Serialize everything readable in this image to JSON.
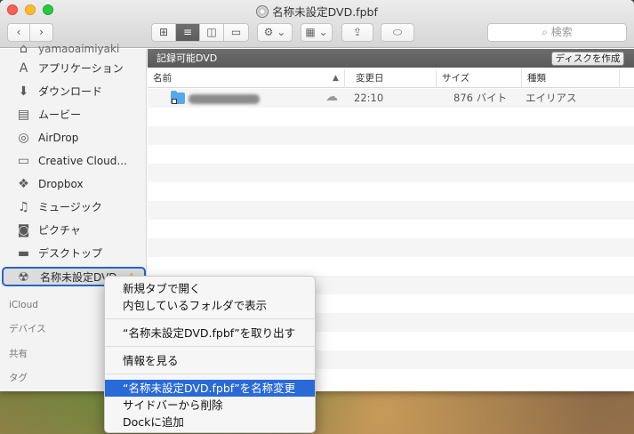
{
  "window": {
    "title": "名称未設定DVD.fpbf"
  },
  "toolbar": {
    "back_label": "‹",
    "forward_label": "›",
    "view_icons_label": "⊞",
    "view_list_label": "≡",
    "view_columns_label": "◫",
    "view_coverflow_label": "▭",
    "action_label": "⚙ ⌄",
    "arrange_label": "▦ ⌄",
    "share_label": "⇪",
    "tags_label": "⬭",
    "search_placeholder": "検索"
  },
  "sidebar": {
    "items": [
      {
        "label": "yamaoaimiyaki",
        "icon": "home-icon"
      },
      {
        "label": "アプリケーション",
        "icon": "applications-icon"
      },
      {
        "label": "ダウンロード",
        "icon": "download-icon"
      },
      {
        "label": "ムービー",
        "icon": "film-icon"
      },
      {
        "label": "AirDrop",
        "icon": "airdrop-icon"
      },
      {
        "label": "Creative Cloud...",
        "icon": "folder-icon"
      },
      {
        "label": "Dropbox",
        "icon": "dropbox-icon"
      },
      {
        "label": "ミュージック",
        "icon": "music-icon"
      },
      {
        "label": "ピクチャ",
        "icon": "camera-icon"
      },
      {
        "label": "デスクトップ",
        "icon": "desktop-icon"
      },
      {
        "label": "名称未設定DVD",
        "icon": "burn-disc-icon"
      }
    ],
    "sections": [
      "iCloud",
      "デバイス",
      "共有",
      "タグ"
    ]
  },
  "pathbar": {
    "title": "記録可能DVD",
    "burn_button": "ディスクを作成"
  },
  "columns": {
    "name": "名前",
    "modified": "変更日",
    "size": "サイズ",
    "kind": "種類"
  },
  "files": [
    {
      "modified": "22:10",
      "size": "876 バイト",
      "kind": "エイリアス"
    }
  ],
  "context_menu": {
    "items": [
      "新規タブで開く",
      "内包しているフォルダで表示",
      "“名称未設定DVD.fpbf”を取り出す",
      "情報を見る",
      "“名称未設定DVD.fpbf”を名称変更",
      "サイドバーから削除",
      "Dockに追加"
    ]
  },
  "colors": {
    "highlight": "#2a6ad6",
    "selection_border": "#2764c9"
  }
}
